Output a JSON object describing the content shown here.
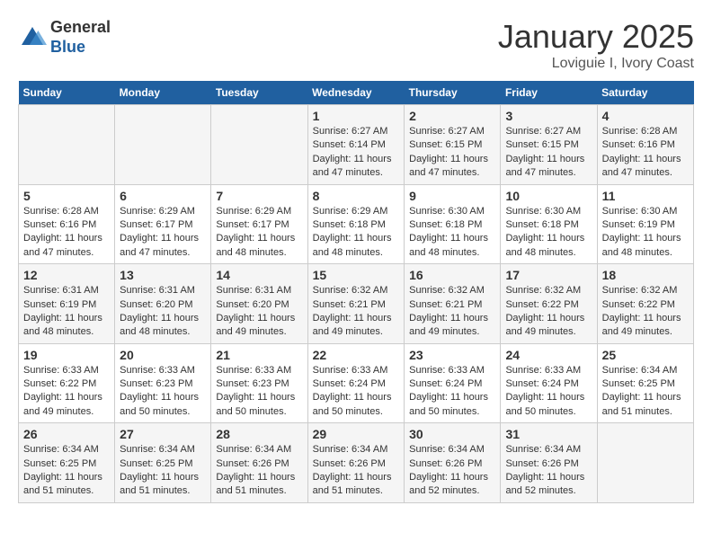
{
  "logo": {
    "general": "General",
    "blue": "Blue"
  },
  "header": {
    "month": "January 2025",
    "location": "Loviguie I, Ivory Coast"
  },
  "days_of_week": [
    "Sunday",
    "Monday",
    "Tuesday",
    "Wednesday",
    "Thursday",
    "Friday",
    "Saturday"
  ],
  "weeks": [
    [
      {
        "day": "",
        "info": ""
      },
      {
        "day": "",
        "info": ""
      },
      {
        "day": "",
        "info": ""
      },
      {
        "day": "1",
        "info": "Sunrise: 6:27 AM\nSunset: 6:14 PM\nDaylight: 11 hours and 47 minutes."
      },
      {
        "day": "2",
        "info": "Sunrise: 6:27 AM\nSunset: 6:15 PM\nDaylight: 11 hours and 47 minutes."
      },
      {
        "day": "3",
        "info": "Sunrise: 6:27 AM\nSunset: 6:15 PM\nDaylight: 11 hours and 47 minutes."
      },
      {
        "day": "4",
        "info": "Sunrise: 6:28 AM\nSunset: 6:16 PM\nDaylight: 11 hours and 47 minutes."
      }
    ],
    [
      {
        "day": "5",
        "info": "Sunrise: 6:28 AM\nSunset: 6:16 PM\nDaylight: 11 hours and 47 minutes."
      },
      {
        "day": "6",
        "info": "Sunrise: 6:29 AM\nSunset: 6:17 PM\nDaylight: 11 hours and 47 minutes."
      },
      {
        "day": "7",
        "info": "Sunrise: 6:29 AM\nSunset: 6:17 PM\nDaylight: 11 hours and 48 minutes."
      },
      {
        "day": "8",
        "info": "Sunrise: 6:29 AM\nSunset: 6:18 PM\nDaylight: 11 hours and 48 minutes."
      },
      {
        "day": "9",
        "info": "Sunrise: 6:30 AM\nSunset: 6:18 PM\nDaylight: 11 hours and 48 minutes."
      },
      {
        "day": "10",
        "info": "Sunrise: 6:30 AM\nSunset: 6:18 PM\nDaylight: 11 hours and 48 minutes."
      },
      {
        "day": "11",
        "info": "Sunrise: 6:30 AM\nSunset: 6:19 PM\nDaylight: 11 hours and 48 minutes."
      }
    ],
    [
      {
        "day": "12",
        "info": "Sunrise: 6:31 AM\nSunset: 6:19 PM\nDaylight: 11 hours and 48 minutes."
      },
      {
        "day": "13",
        "info": "Sunrise: 6:31 AM\nSunset: 6:20 PM\nDaylight: 11 hours and 48 minutes."
      },
      {
        "day": "14",
        "info": "Sunrise: 6:31 AM\nSunset: 6:20 PM\nDaylight: 11 hours and 49 minutes."
      },
      {
        "day": "15",
        "info": "Sunrise: 6:32 AM\nSunset: 6:21 PM\nDaylight: 11 hours and 49 minutes."
      },
      {
        "day": "16",
        "info": "Sunrise: 6:32 AM\nSunset: 6:21 PM\nDaylight: 11 hours and 49 minutes."
      },
      {
        "day": "17",
        "info": "Sunrise: 6:32 AM\nSunset: 6:22 PM\nDaylight: 11 hours and 49 minutes."
      },
      {
        "day": "18",
        "info": "Sunrise: 6:32 AM\nSunset: 6:22 PM\nDaylight: 11 hours and 49 minutes."
      }
    ],
    [
      {
        "day": "19",
        "info": "Sunrise: 6:33 AM\nSunset: 6:22 PM\nDaylight: 11 hours and 49 minutes."
      },
      {
        "day": "20",
        "info": "Sunrise: 6:33 AM\nSunset: 6:23 PM\nDaylight: 11 hours and 50 minutes."
      },
      {
        "day": "21",
        "info": "Sunrise: 6:33 AM\nSunset: 6:23 PM\nDaylight: 11 hours and 50 minutes."
      },
      {
        "day": "22",
        "info": "Sunrise: 6:33 AM\nSunset: 6:24 PM\nDaylight: 11 hours and 50 minutes."
      },
      {
        "day": "23",
        "info": "Sunrise: 6:33 AM\nSunset: 6:24 PM\nDaylight: 11 hours and 50 minutes."
      },
      {
        "day": "24",
        "info": "Sunrise: 6:33 AM\nSunset: 6:24 PM\nDaylight: 11 hours and 50 minutes."
      },
      {
        "day": "25",
        "info": "Sunrise: 6:34 AM\nSunset: 6:25 PM\nDaylight: 11 hours and 51 minutes."
      }
    ],
    [
      {
        "day": "26",
        "info": "Sunrise: 6:34 AM\nSunset: 6:25 PM\nDaylight: 11 hours and 51 minutes."
      },
      {
        "day": "27",
        "info": "Sunrise: 6:34 AM\nSunset: 6:25 PM\nDaylight: 11 hours and 51 minutes."
      },
      {
        "day": "28",
        "info": "Sunrise: 6:34 AM\nSunset: 6:26 PM\nDaylight: 11 hours and 51 minutes."
      },
      {
        "day": "29",
        "info": "Sunrise: 6:34 AM\nSunset: 6:26 PM\nDaylight: 11 hours and 51 minutes."
      },
      {
        "day": "30",
        "info": "Sunrise: 6:34 AM\nSunset: 6:26 PM\nDaylight: 11 hours and 52 minutes."
      },
      {
        "day": "31",
        "info": "Sunrise: 6:34 AM\nSunset: 6:26 PM\nDaylight: 11 hours and 52 minutes."
      },
      {
        "day": "",
        "info": ""
      }
    ]
  ]
}
